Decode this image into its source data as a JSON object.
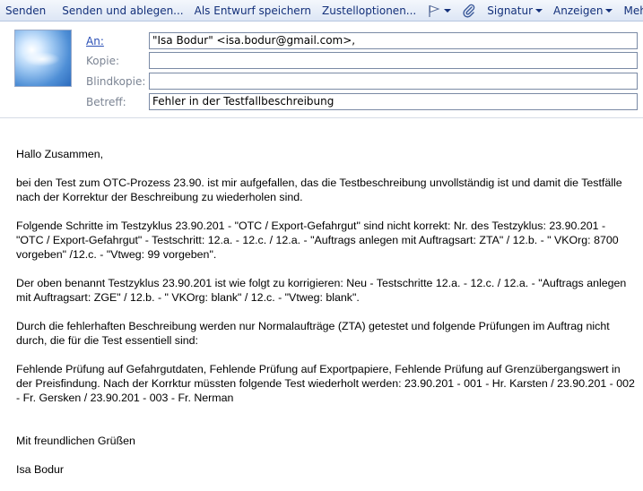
{
  "toolbar": {
    "send": "Senden",
    "send_and_file": "Senden und ablegen...",
    "save_draft": "Als Entwurf speichern",
    "delivery_options": "Zustelloptionen...",
    "signature": "Signatur",
    "display": "Anzeigen",
    "more": "Mehr"
  },
  "header": {
    "to_label": "An:",
    "to_value": "\"Isa Bodur\" <isa.bodur@gmail.com>,",
    "cc_label": "Kopie:",
    "cc_value": "",
    "bcc_label": "Blindkopie:",
    "bcc_value": "",
    "subject_label": "Betreff:",
    "subject_value": "Fehler in der Testfallbeschreibung"
  },
  "body": {
    "greeting": "Hallo Zusammen,",
    "p1": "bei den Test zum OTC-Prozess 23.90. ist mir aufgefallen, das die Testbeschreibung unvollständig ist und damit die Testfälle nach der Korrektur der Beschreibung zu wiederholen sind.",
    "p2": "Folgende Schritte im Testzyklus 23.90.201 - \"OTC / Export-Gefahrgut\" sind nicht korrekt: Nr. des Testzyklus: 23.90.201 - \"OTC / Export-Gefahrgut\" - Testschritt: 12.a. - 12.c. / 12.a. - \"Auftrags anlegen mit Auftragsart: ZTA\" / 12.b. - \" VKOrg: 8700 vorgeben\" /12.c. - \"Vtweg: 99 vorgeben\".",
    "p3": "Der oben benannt Testzyklus 23.90.201 ist wie folgt zu korrigieren: Neu - Testschritte 12.a. - 12.c. / 12.a. - \"Auftrags anlegen mit Auftragsart: ZGE\" / 12.b. - \" VKOrg: blank\" / 12.c. - \"Vtweg: blank\".",
    "p4": "Durch die fehlerhaften Beschreibung werden nur Normalaufträge (ZTA) getestet und folgende Prüfungen im Auftrag nicht durch, die für die Test essentiell sind:",
    "p5": "Fehlende Prüfung auf Gefahrgutdaten, Fehlende Prüfung auf Exportpapiere, Fehlende Prüfung auf Grenzübergangswert in der Preisfindung. Nach der Korrktur müssten folgende Test wiederholt werden: 23.90.201 - 001 - Hr. Karsten / 23.90.201 - 002 - Fr. Gersken / 23.90.201 - 003 - Fr. Nerman",
    "closing": "Mit freundlichen Grüßen",
    "signature": "Isa Bodur"
  }
}
